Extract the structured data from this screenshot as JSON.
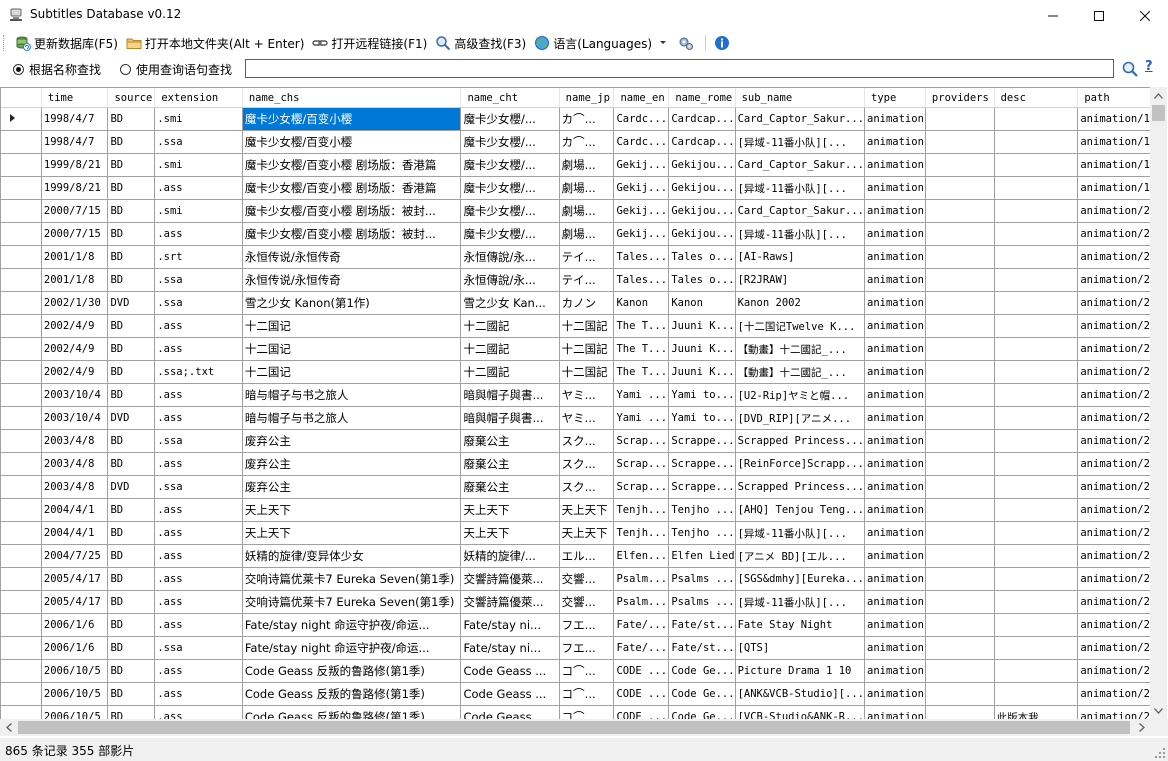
{
  "window": {
    "title": "Subtitles Database v0.12"
  },
  "toolbar": {
    "update_label": "更新数据库(F5)",
    "open_local_label": "打开本地文件夹(Alt + Enter)",
    "open_remote_label": "打开远程链接(F1)",
    "advanced_search_label": "高级查找(F3)",
    "language_label": "语言(Languages)"
  },
  "search": {
    "radio_name_label": "根据名称查找",
    "radio_query_label": "使用查询语句查找",
    "value": "",
    "help_label": "?"
  },
  "grid": {
    "columns": [
      "time",
      "source",
      "extension",
      "name_chs",
      "name_cht",
      "name_jp",
      "name_en",
      "name_rome",
      "sub_name",
      "type",
      "providers",
      "desc",
      "path"
    ],
    "rows": [
      [
        "1998/4/7",
        "BD",
        ".smi",
        "魔卡少女樱/百变小樱",
        "魔卡少女櫻/...",
        "カ⌒...",
        "Cardc...",
        "Cardcap...",
        "Card_Captor_Sakur...",
        "animation",
        "",
        "",
        "animation/1"
      ],
      [
        "1998/4/7",
        "BD",
        ".ssa",
        "魔卡少女樱/百变小樱",
        "魔卡少女櫻/...",
        "カ⌒...",
        "Cardc...",
        "Cardcap...",
        "[异域-11番小队][...",
        "animation",
        "",
        "",
        "animation/1"
      ],
      [
        "1999/8/21",
        "BD",
        ".smi",
        "魔卡少女樱/百变小樱 剧场版：香港篇",
        "魔卡少女櫻/...",
        "劇場...",
        "Gekij...",
        "Gekijou...",
        "Card_Captor_Sakur...",
        "animation",
        "",
        "",
        "animation/1"
      ],
      [
        "1999/8/21",
        "BD",
        ".ass",
        "魔卡少女樱/百变小樱 剧场版：香港篇",
        "魔卡少女櫻/...",
        "劇場...",
        "Gekij...",
        "Gekijou...",
        "[异域-11番小队][...",
        "animation",
        "",
        "",
        "animation/1"
      ],
      [
        "2000/7/15",
        "BD",
        ".smi",
        "魔卡少女樱/百变小樱 剧场版：被封...",
        "魔卡少女櫻/...",
        "劇場...",
        "Gekij...",
        "Gekijou...",
        "Card_Captor_Sakur...",
        "animation",
        "",
        "",
        "animation/2"
      ],
      [
        "2000/7/15",
        "BD",
        ".ass",
        "魔卡少女樱/百变小樱 剧场版：被封...",
        "魔卡少女櫻/...",
        "劇場...",
        "Gekij...",
        "Gekijou...",
        "[异域-11番小队][...",
        "animation",
        "",
        "",
        "animation/2"
      ],
      [
        "2001/1/8",
        "BD",
        ".srt",
        "永恒传说/永恒传奇",
        "永恒傳說/永...",
        "テイ...",
        "Tales...",
        "Tales o...",
        "[AI-Raws]",
        "animation",
        "",
        "",
        "animation/2"
      ],
      [
        "2001/1/8",
        "BD",
        ".ssa",
        "永恒传说/永恒传奇",
        "永恒傳說/永...",
        "テイ...",
        "Tales...",
        "Tales o...",
        "[R2JRAW]",
        "animation",
        "",
        "",
        "animation/2"
      ],
      [
        "2002/1/30",
        "DVD",
        ".ssa",
        "雪之少女 Kanon(第1作)",
        "雪之少女 Kan...",
        "カノン",
        "Kanon",
        "Kanon",
        "Kanon 2002",
        "animation",
        "",
        "",
        "animation/2"
      ],
      [
        "2002/4/9",
        "BD",
        ".ass",
        "十二国记",
        "十二國記",
        "十二国記",
        "The T...",
        "Juuni K...",
        "[十二国记Twelve K...",
        "animation",
        "",
        "",
        "animation/2"
      ],
      [
        "2002/4/9",
        "BD",
        ".ass",
        "十二国记",
        "十二國記",
        "十二国記",
        "The T...",
        "Juuni K...",
        "【動畫】十二國記_...",
        "animation",
        "",
        "",
        "animation/2"
      ],
      [
        "2002/4/9",
        "BD",
        ".ssa;.txt",
        "十二国记",
        "十二國記",
        "十二国記",
        "The T...",
        "Juuni K...",
        "【動畫】十二國記_...",
        "animation",
        "",
        "",
        "animation/2"
      ],
      [
        "2003/10/4",
        "BD",
        ".ass",
        "暗与帽子与书之旅人",
        "暗與帽子與書...",
        "ヤミ...",
        "Yami ...",
        "Yami to...",
        "[U2-Rip]ヤミと帽...",
        "animation",
        "",
        "",
        "animation/2"
      ],
      [
        "2003/10/4",
        "DVD",
        ".ass",
        "暗与帽子与书之旅人",
        "暗與帽子與書...",
        "ヤミ...",
        "Yami ...",
        "Yami to...",
        "[DVD_RIP][アニメ...",
        "animation",
        "",
        "",
        "animation/2"
      ],
      [
        "2003/4/8",
        "BD",
        ".ssa",
        "废弃公主",
        "廢棄公主",
        "スク...",
        "Scrap...",
        "Scrappe...",
        "Scrapped Princess...",
        "animation",
        "",
        "",
        "animation/2"
      ],
      [
        "2003/4/8",
        "BD",
        ".ass",
        "废弃公主",
        "廢棄公主",
        "スク...",
        "Scrap...",
        "Scrappe...",
        "[ReinForce]Scrapp...",
        "animation",
        "",
        "",
        "animation/2"
      ],
      [
        "2003/4/8",
        "DVD",
        ".ssa",
        "废弃公主",
        "廢棄公主",
        "スク...",
        "Scrap...",
        "Scrappe...",
        "Scrapped Princess...",
        "animation",
        "",
        "",
        "animation/2"
      ],
      [
        "2004/4/1",
        "BD",
        ".ass",
        "天上天下",
        "天上天下",
        "天上天下",
        "Tenjh...",
        "Tenjho ...",
        "[AHQ] Tenjou Teng...",
        "animation",
        "",
        "",
        "animation/2"
      ],
      [
        "2004/4/1",
        "BD",
        ".ass",
        "天上天下",
        "天上天下",
        "天上天下",
        "Tenjh...",
        "Tenjho ...",
        "[异域-11番小队][...",
        "animation",
        "",
        "",
        "animation/2"
      ],
      [
        "2004/7/25",
        "BD",
        ".ass",
        "妖精的旋律/变异体少女",
        "妖精的旋律/...",
        "エル...",
        "Elfen...",
        "Elfen Lied",
        "[アニメ BD][エル...",
        "animation",
        "",
        "",
        "animation/2"
      ],
      [
        "2005/4/17",
        "BD",
        ".ass",
        "交响诗篇优莱卡7 Eureka Seven(第1季)",
        "交響詩篇優萊...",
        "交響...",
        "Psalm...",
        "Psalms ...",
        "[SGS&dmhy][Eureka...",
        "animation",
        "",
        "",
        "animation/2"
      ],
      [
        "2005/4/17",
        "BD",
        ".ass",
        "交响诗篇优莱卡7 Eureka Seven(第1季)",
        "交響詩篇優萊...",
        "交響...",
        "Psalm...",
        "Psalms ...",
        "[异域-11番小队][...",
        "animation",
        "",
        "",
        "animation/2"
      ],
      [
        "2006/1/6",
        "BD",
        ".ass",
        "Fate/stay night 命运守护夜/命运...",
        "Fate/stay ni...",
        "フエ...",
        "Fate/...",
        "Fate/st...",
        "Fate Stay Night",
        "animation",
        "",
        "",
        "animation/2"
      ],
      [
        "2006/1/6",
        "BD",
        ".ssa",
        "Fate/stay night 命运守护夜/命运...",
        "Fate/stay ni...",
        "フエ...",
        "Fate/...",
        "Fate/st...",
        "[QTS]",
        "animation",
        "",
        "",
        "animation/2"
      ],
      [
        "2006/10/5",
        "BD",
        ".ass",
        "Code Geass 反叛的鲁路修(第1季)",
        "Code Geass ...",
        "コ⌒...",
        "CODE ...",
        "Code Ge...",
        "Picture Drama 1 10",
        "animation",
        "",
        "",
        "animation/2"
      ],
      [
        "2006/10/5",
        "BD",
        ".ass",
        "Code Geass 反叛的鲁路修(第1季)",
        "Code Geass ...",
        "コ⌒...",
        "CODE ...",
        "Code Ge...",
        "[ANK&VCB-Studio][...",
        "animation",
        "",
        "",
        "animation/2"
      ],
      [
        "2006/10/5",
        "BD",
        ".ass",
        "Code Geass 反叛的鲁路修(第1季)",
        "Code Geass ...",
        "コ⌒...",
        "CODE ...",
        "Code Ge...",
        "[VCB-Studio&ANK-R...",
        "animation",
        "",
        "此版本我...",
        "animation/2"
      ]
    ]
  },
  "status": {
    "text": "865 条记录  355 部影片"
  }
}
